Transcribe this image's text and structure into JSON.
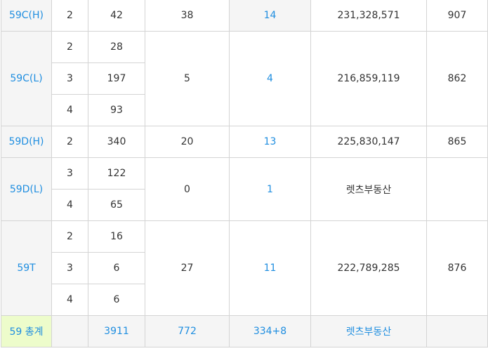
{
  "rows": {
    "r59ch": {
      "type": "59C(H)",
      "c1": "2",
      "c2": "42",
      "c3": "38",
      "c4": "14",
      "c5": "231,328,571",
      "c6": "907"
    },
    "r59cl": {
      "type": "59C(L)",
      "subs": [
        {
          "a": "2",
          "b": "28"
        },
        {
          "a": "3",
          "b": "197"
        },
        {
          "a": "4",
          "b": "93"
        }
      ],
      "c3": "5",
      "c4": "4",
      "c5": "216,859,119",
      "c6": "862"
    },
    "r59dh": {
      "type": "59D(H)",
      "c1": "2",
      "c2": "340",
      "c3": "20",
      "c4": "13",
      "c5": "225,830,147",
      "c6": "865"
    },
    "r59dl": {
      "type": "59D(L)",
      "subs": [
        {
          "a": "3",
          "b": "122"
        },
        {
          "a": "4",
          "b": "65"
        }
      ],
      "c3": "0",
      "c4": "1",
      "c5": "렛츠부동산",
      "c6": ""
    },
    "r59t": {
      "type": "59T",
      "subs": [
        {
          "a": "2",
          "b": "16"
        },
        {
          "a": "3",
          "b": "6"
        },
        {
          "a": "4",
          "b": "6"
        }
      ],
      "c3": "27",
      "c4": "11",
      "c5": "222,789,285",
      "c6": "876"
    }
  },
  "total": {
    "label": "59 총계",
    "c1": "",
    "c2": "3911",
    "c3": "772",
    "c4": "334+8",
    "c5": "렛츠부동산",
    "c6": ""
  }
}
